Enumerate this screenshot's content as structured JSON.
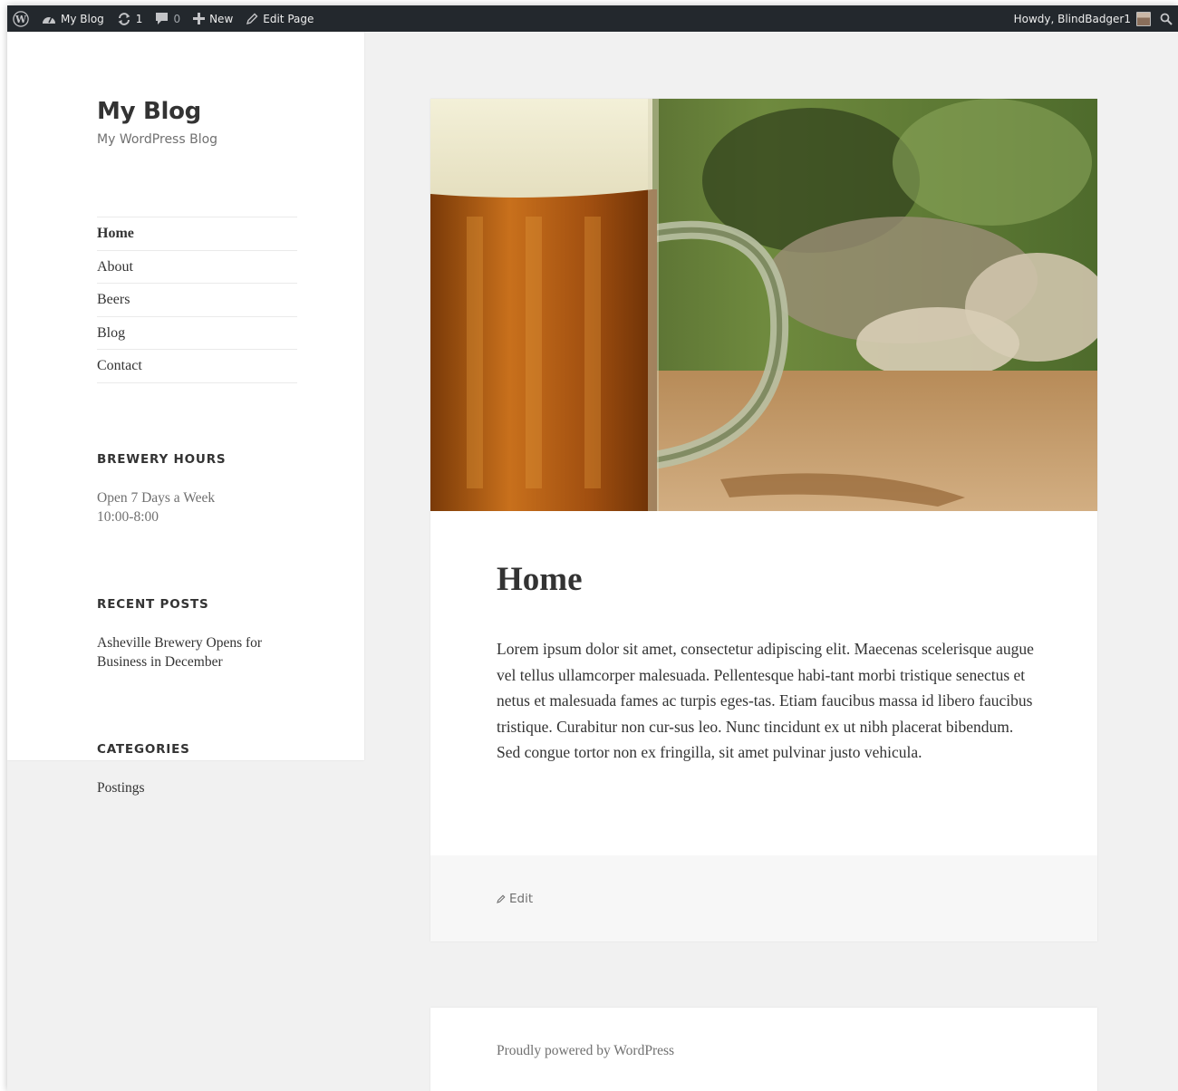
{
  "admin_bar": {
    "site_name": "My Blog",
    "updates_count": "1",
    "comments_count": "0",
    "new_label": "New",
    "edit_page_label": "Edit Page",
    "greeting": "Howdy, BlindBadger1",
    "background": "#23282d"
  },
  "site": {
    "title": "My Blog",
    "description": "My WordPress Blog"
  },
  "nav": {
    "items": [
      {
        "label": "Home"
      },
      {
        "label": "About"
      },
      {
        "label": "Beers"
      },
      {
        "label": "Blog"
      },
      {
        "label": "Contact"
      }
    ],
    "active": "Home"
  },
  "widgets": {
    "hours": {
      "title": "BREWERY HOURS",
      "line1": "Open 7 Days a Week",
      "line2": "10:00-8:00"
    },
    "recent_posts": {
      "title": "RECENT POSTS",
      "items": [
        {
          "label": "Asheville Brewery Opens for Business in December"
        }
      ]
    },
    "categories": {
      "title": "CATEGORIES",
      "items": [
        {
          "label": "Postings"
        }
      ]
    }
  },
  "post": {
    "title": "Home",
    "content": "Lorem ipsum dolor sit amet, consectetur adipiscing elit. Maecenas scelerisque augue vel tellus ullamcorper malesuada. Pellentesque habi-tant morbi tristique senectus et netus et malesuada fames ac turpis eges-tas. Etiam faucibus massa id libero faucibus tristique. Curabitur non cur-sus leo. Nunc tincidunt ex ut nibh placerat bibendum. Sed congue tortor non ex fringilla, sit amet pulvinar justo vehicula.",
    "edit_label": "Edit"
  },
  "footer": {
    "powered_by": "Proudly powered by WordPress"
  },
  "icons": [
    "wordpress-logo-icon",
    "dashboard-icon",
    "updates-icon",
    "comments-icon",
    "plus-icon",
    "pencil-icon",
    "search-icon"
  ]
}
